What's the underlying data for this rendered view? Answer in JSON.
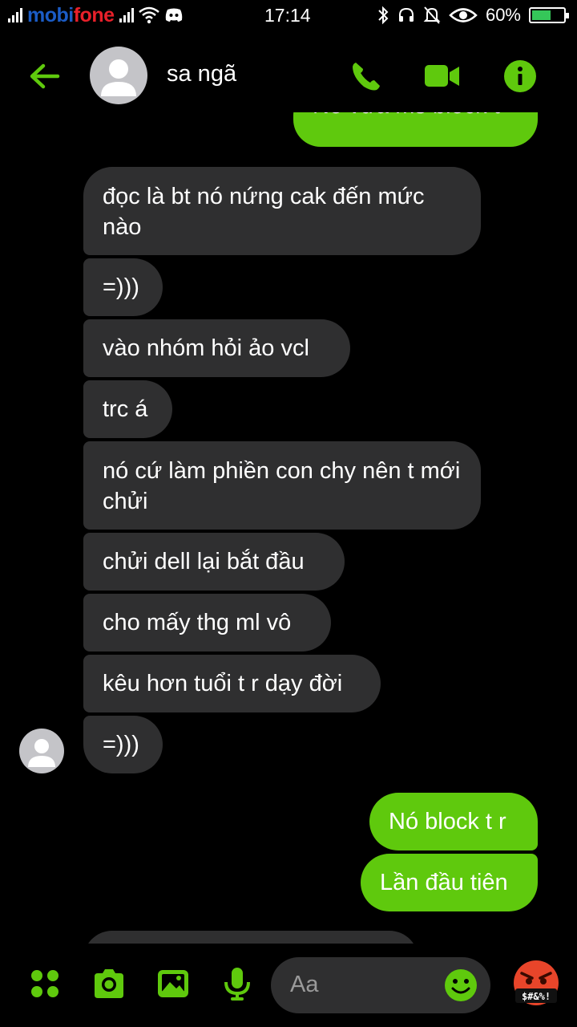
{
  "status_bar": {
    "carrier_a": "mobi",
    "carrier_b": "fone",
    "time": "17:14",
    "battery": "60%",
    "battery_level": 0.6
  },
  "header": {
    "contact_name": "sa ngã"
  },
  "messages": [
    {
      "text": "Nó vừa ms block t"
    },
    {
      "text": "đọc là bt nó nứng cak đến mức nào"
    },
    {
      "text": "=)))"
    },
    {
      "text": "vào nhóm hỏi ảo vcl"
    },
    {
      "text": "trc á"
    },
    {
      "text": "nó cứ làm phiền con chy nên t mới chửi"
    },
    {
      "text": "chửi dell lại bắt đầu"
    },
    {
      "text": "cho mấy thg ml vô"
    },
    {
      "text": "kêu hơn tuổi t r dạy đời"
    },
    {
      "text": "=)))"
    },
    {
      "text": "Nó block t r"
    },
    {
      "text": "Lần đầu tiên"
    }
  ],
  "composer": {
    "placeholder": "Aa",
    "reaction_label": "$#&%!"
  },
  "colors": {
    "accent": "#5fc90d",
    "incoming_bubble": "#2f2f30",
    "background": "#000000"
  },
  "icons": [
    "back-arrow-icon",
    "phone-icon",
    "video-icon",
    "info-icon",
    "apps-icon",
    "camera-icon",
    "image-icon",
    "mic-icon",
    "smiley-icon",
    "angry-face-icon"
  ]
}
